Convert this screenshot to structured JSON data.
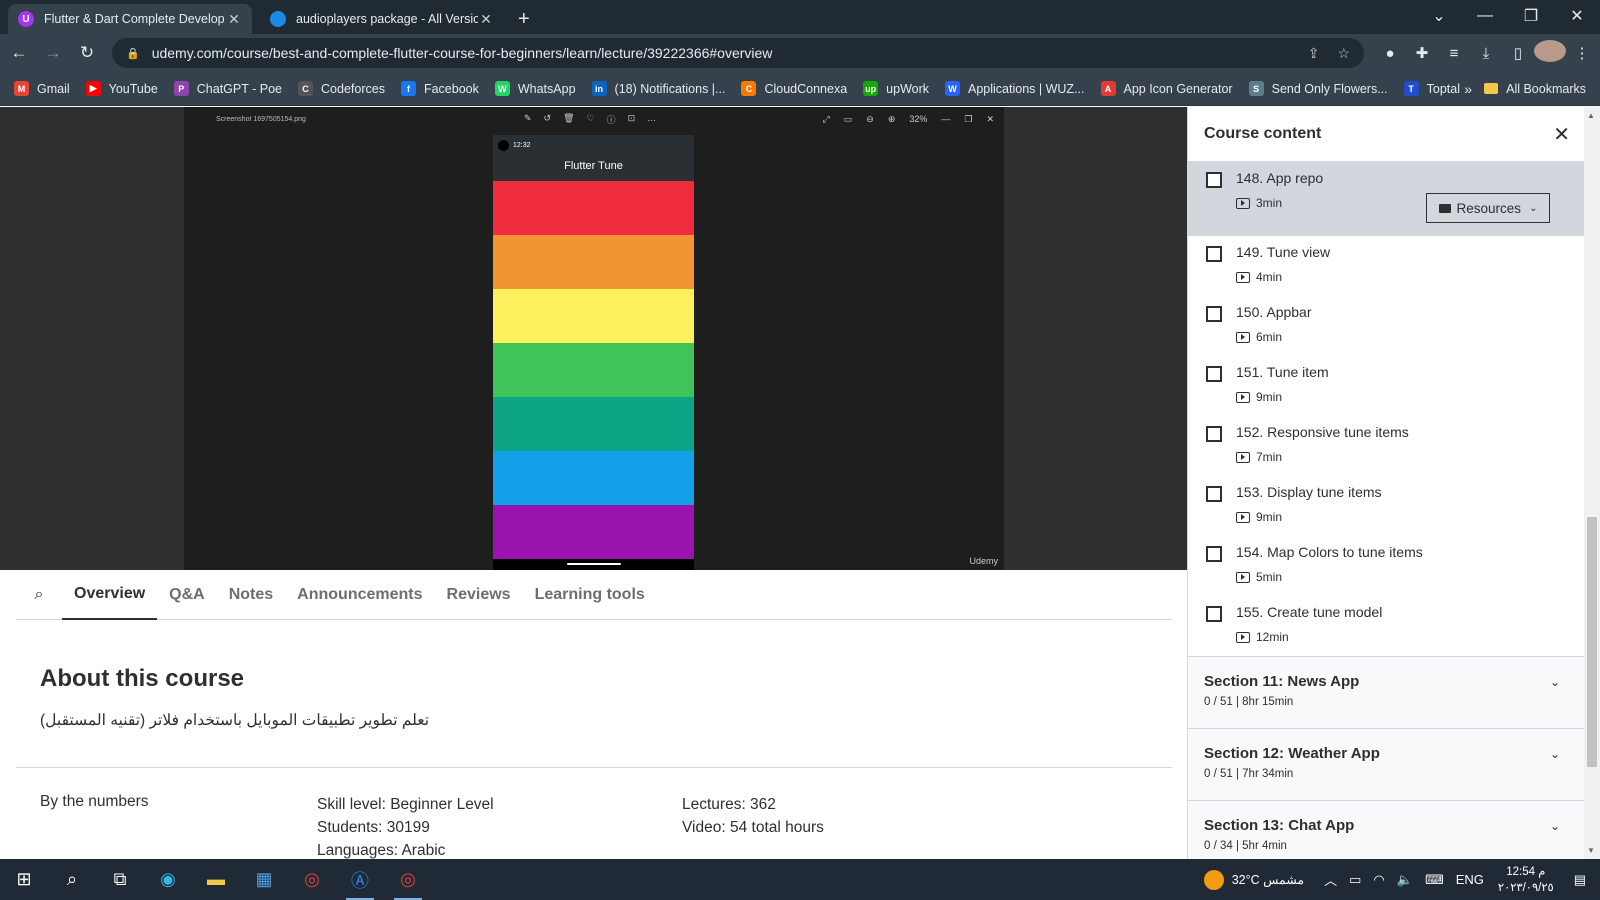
{
  "browser": {
    "tabs": [
      {
        "title": "Flutter & Dart Complete Develop",
        "active": true,
        "favicon_color": "#a435f0",
        "favicon_text": "U"
      },
      {
        "title": "audioplayers package - All Versio",
        "active": false,
        "favicon_color": "#1e88e5",
        "favicon_text": ""
      }
    ],
    "url": "udemy.com/course/best-and-complete-flutter-course-for-beginners/learn/lecture/39222366#overview",
    "bookmarks": [
      {
        "label": "Gmail",
        "color": "#ea4335",
        "glyph": "M"
      },
      {
        "label": "YouTube",
        "color": "#ff0000",
        "glyph": "▶"
      },
      {
        "label": "ChatGPT - Poe",
        "color": "#8e44ad",
        "glyph": "P"
      },
      {
        "label": "Codeforces",
        "color": "#555555",
        "glyph": "C"
      },
      {
        "label": "Facebook",
        "color": "#1877f2",
        "glyph": "f"
      },
      {
        "label": "WhatsApp",
        "color": "#25d366",
        "glyph": "W"
      },
      {
        "label": "(18) Notifications |...",
        "color": "#0a66c2",
        "glyph": "in"
      },
      {
        "label": "CloudConnexa",
        "color": "#f57c00",
        "glyph": "C"
      },
      {
        "label": "upWork",
        "color": "#14a800",
        "glyph": "up"
      },
      {
        "label": "Applications | WUZ...",
        "color": "#2962ff",
        "glyph": "W"
      },
      {
        "label": "App Icon Generator",
        "color": "#e53935",
        "glyph": "A"
      },
      {
        "label": "Send Only Flowers...",
        "color": "#607d8b",
        "glyph": "S"
      },
      {
        "label": "Toptal",
        "color": "#204ecf",
        "glyph": "T"
      }
    ],
    "all_bookmarks": "All Bookmarks",
    "more": "»"
  },
  "viewer": {
    "filename": "Screenshot 1697505154.png",
    "zoom": "32%",
    "watermark": "Udemy",
    "phone": {
      "time": "12:32",
      "app_title": "Flutter Tune",
      "stripes": [
        "#ef2d3e",
        "#f39433",
        "#fdf05d",
        "#3fc45a",
        "#0ea486",
        "#12a0e8",
        "#9a13ae"
      ]
    }
  },
  "tabs_nav": {
    "items": [
      "Overview",
      "Q&A",
      "Notes",
      "Announcements",
      "Reviews",
      "Learning tools"
    ],
    "active": "Overview"
  },
  "about": {
    "heading": "About this course",
    "description": "تعلم تطوير تطبيقات الموبايل باستخدام فلاتر (تقنيه المستقبل)",
    "numbers_label": "By the numbers",
    "skill": "Skill level: Beginner Level",
    "students": "Students: 30199",
    "languages": "Languages: Arabic",
    "lectures": "Lectures: 362",
    "video": "Video: 54 total hours"
  },
  "sidebar": {
    "title": "Course content",
    "resources_label": "Resources",
    "lectures": [
      {
        "title": "148. App repo",
        "duration": "3min",
        "current": true
      },
      {
        "title": "149. Tune view",
        "duration": "4min",
        "current": false
      },
      {
        "title": "150. Appbar",
        "duration": "6min",
        "current": false
      },
      {
        "title": "151. Tune item",
        "duration": "9min",
        "current": false
      },
      {
        "title": "152. Responsive tune items",
        "duration": "7min",
        "current": false
      },
      {
        "title": "153. Display tune items",
        "duration": "9min",
        "current": false
      },
      {
        "title": "154. Map Colors to tune items",
        "duration": "5min",
        "current": false
      },
      {
        "title": "155. Create tune model",
        "duration": "12min",
        "current": false
      }
    ],
    "sections": [
      {
        "title": "Section 11: News App",
        "meta": "0 / 51 | 8hr 15min"
      },
      {
        "title": "Section 12: Weather App",
        "meta": "0 / 51 | 7hr 34min"
      },
      {
        "title": "Section 13: Chat App",
        "meta": "0 / 34 | 5hr 4min"
      }
    ]
  },
  "taskbar": {
    "weather": "32°C  مشمس",
    "lang": "ENG",
    "time": "12:54 م",
    "date": "٢٠٢٣/٠٩/٢٥"
  }
}
